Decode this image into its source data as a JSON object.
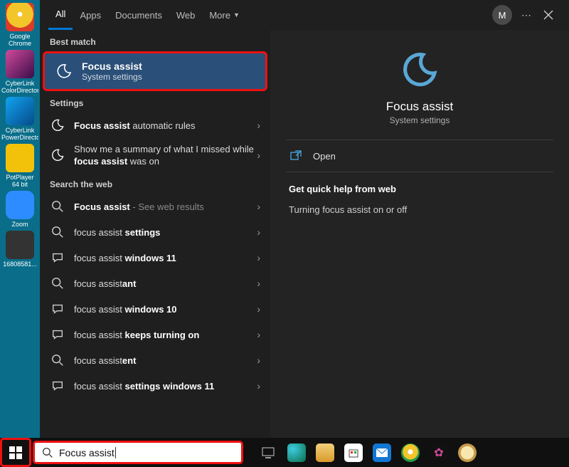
{
  "desktop_icons": [
    {
      "label": "Google Chrome",
      "color": "#f2c52a"
    },
    {
      "label": "CyberLink ColorDirector",
      "color": "#6d126f"
    },
    {
      "label": "CyberLink PowerDirector",
      "color": "#0e6fcf"
    },
    {
      "label": "PotPlayer 64 bit",
      "color": "#f2c20a"
    },
    {
      "label": "Zoom",
      "color": "#2d8cff"
    },
    {
      "label": "16808581...",
      "color": "#333333"
    }
  ],
  "tabs": {
    "all": "All",
    "apps": "Apps",
    "documents": "Documents",
    "web": "Web",
    "more": "More"
  },
  "avatar_initial": "M",
  "sections": {
    "best": "Best match",
    "settings": "Settings",
    "web": "Search the web"
  },
  "best_match": {
    "title": "Focus assist",
    "subtitle": "System settings"
  },
  "settings_items": [
    {
      "pre": "",
      "bold": "Focus assist",
      "post": " automatic rules",
      "icon": "moon"
    },
    {
      "pre": "Show me a summary of what I missed while ",
      "bold": "focus assist",
      "post": " was on",
      "icon": "moon"
    }
  ],
  "web_items": [
    {
      "pre": "",
      "bold": "Focus assist",
      "post": "",
      "dash": " - See web results",
      "icon": "search"
    },
    {
      "pre": "focus assist ",
      "bold": "settings",
      "post": "",
      "icon": "search"
    },
    {
      "pre": "focus assist ",
      "bold": "windows 11",
      "post": "",
      "icon": "chat"
    },
    {
      "pre": "focus assist",
      "bold": "ant",
      "post": "",
      "icon": "search"
    },
    {
      "pre": "focus assist ",
      "bold": "windows 10",
      "post": "",
      "icon": "chat"
    },
    {
      "pre": "focus assist ",
      "bold": "keeps turning on",
      "post": "",
      "icon": "chat"
    },
    {
      "pre": "focus assist",
      "bold": "ent",
      "post": "",
      "icon": "search"
    },
    {
      "pre": "focus assist ",
      "bold": "settings windows 11",
      "post": "",
      "icon": "chat"
    }
  ],
  "detail": {
    "title": "Focus assist",
    "subtitle": "System settings",
    "open": "Open",
    "quick_help_heading": "Get quick help from web",
    "quick_help_item": "Turning focus assist on or off"
  },
  "search_value": "Focus assist",
  "taskbar_apps": [
    {
      "name": "task-view",
      "color": "#a0a0a0"
    },
    {
      "name": "edge",
      "color": "#1e8e9e"
    },
    {
      "name": "file-explorer",
      "color": "#f3b63a"
    },
    {
      "name": "microsoft-store",
      "color": "#3a3a6a"
    },
    {
      "name": "mail",
      "color": "#1277d3"
    },
    {
      "name": "chrome",
      "color": "#f2c52a"
    },
    {
      "name": "user-app-1",
      "color": "#b43a7a"
    },
    {
      "name": "paint",
      "color": "#2a6fb0"
    }
  ],
  "chevron": "›"
}
